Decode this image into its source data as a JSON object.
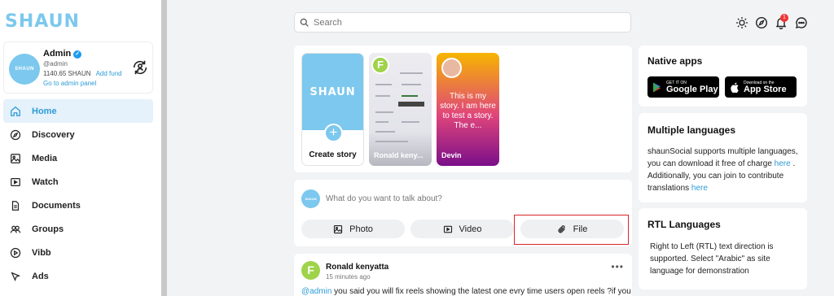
{
  "brand": {
    "logo": "SHAUN"
  },
  "profile": {
    "name": "Admin",
    "handle": "@admin",
    "balance": "1140.65 SHAUN",
    "add_fund": "Add fund",
    "admin_panel": "Go to admin panel",
    "avatar_text": "SHAUN"
  },
  "nav": [
    {
      "label": "Home",
      "icon": "home-icon",
      "active": true
    },
    {
      "label": "Discovery",
      "icon": "compass-icon"
    },
    {
      "label": "Media",
      "icon": "image-icon"
    },
    {
      "label": "Watch",
      "icon": "video-icon"
    },
    {
      "label": "Documents",
      "icon": "document-icon"
    },
    {
      "label": "Groups",
      "icon": "groups-icon"
    },
    {
      "label": "Vibb",
      "icon": "vibb-icon"
    },
    {
      "label": "Ads",
      "icon": "ads-icon"
    }
  ],
  "search": {
    "placeholder": "Search"
  },
  "topbar": {
    "notification_count": "1"
  },
  "stories": {
    "create_label": "Create story",
    "create_logo": "SHAUN",
    "items": [
      {
        "name": "Ronald keny...",
        "avatar_letter": "F"
      },
      {
        "name": "Devin",
        "text": "This is my story. I am here to test a story. The e..."
      }
    ]
  },
  "composer": {
    "prompt": "What do you want to talk about?",
    "avatar_text": "SHAUN",
    "photo_label": "Photo",
    "video_label": "Video",
    "file_label": "File"
  },
  "post": {
    "author": "Ronald kenyatta",
    "time": "15 minutes ago",
    "avatar_letter": "F",
    "mention": "@admin",
    "text": " you said you will fix reels showing the latest one evry time users open reels ?if you"
  },
  "native_apps": {
    "title": "Native apps",
    "google_small": "GET IT ON",
    "google_big": "Google Play",
    "apple_small": "Download on the",
    "apple_big": "App Store"
  },
  "languages": {
    "title": "Multiple languages",
    "text1": "shaunSocial supports multiple languages, you can download it free of charge ",
    "link1": "here",
    "text2": " . Additionally, you can join to contribute translations ",
    "link2": "here"
  },
  "rtl": {
    "title": "RTL Languages",
    "text": "Right to Left (RTL) text direction is supported. Select \"Arabic\" as site language for demonstration"
  }
}
